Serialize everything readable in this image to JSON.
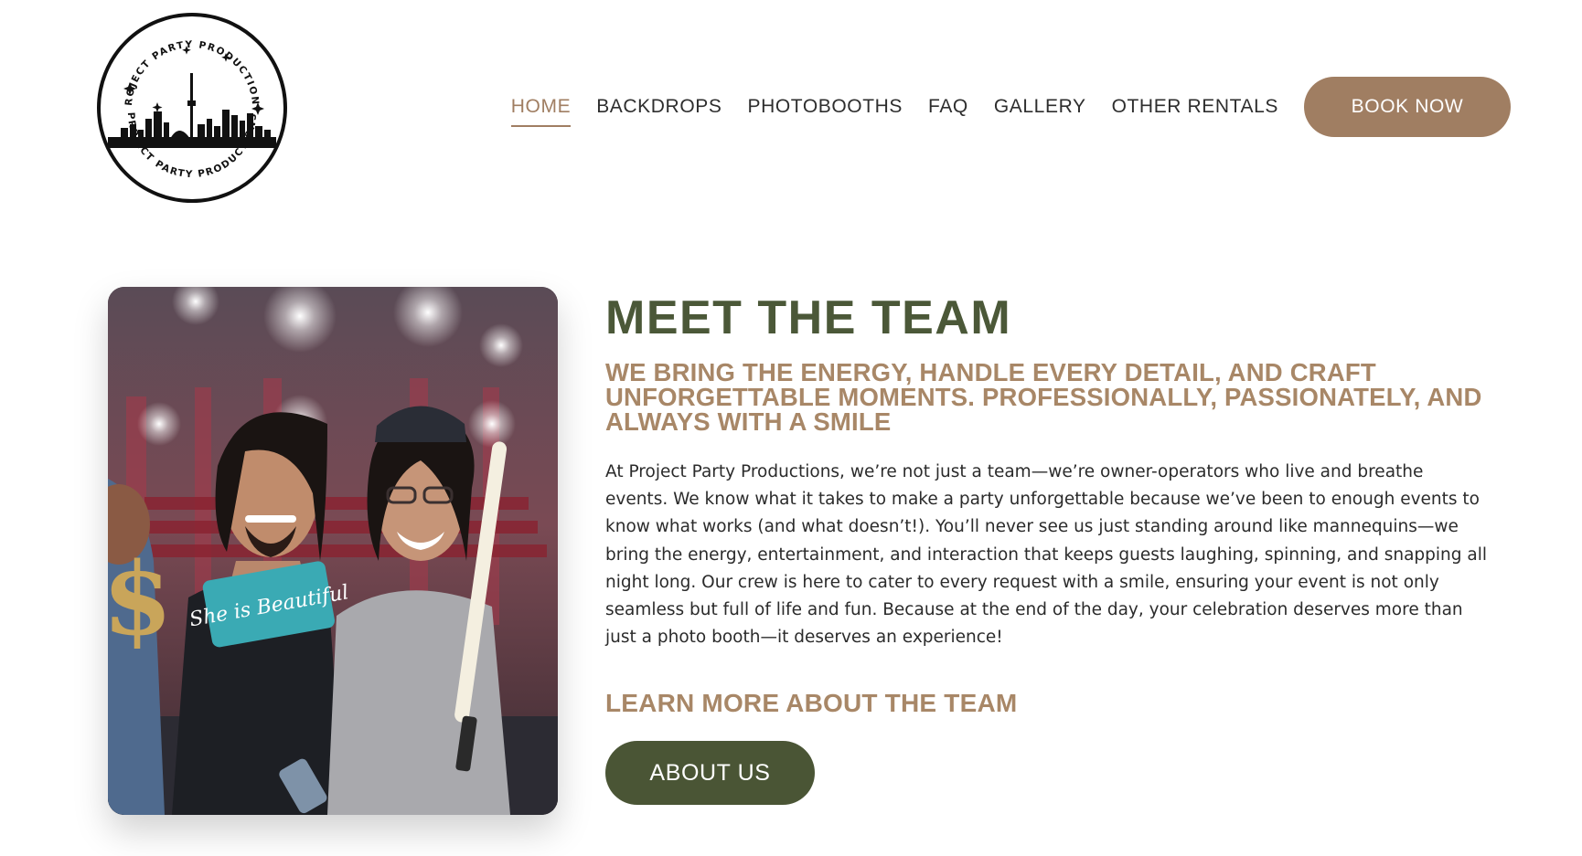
{
  "brand": {
    "logo_text": "PROJECT PARTY PRODUCTIONS",
    "logo_icon": "toronto-skyline-icon"
  },
  "nav": {
    "items": [
      {
        "label": "HOME",
        "active": true
      },
      {
        "label": "BACKDROPS",
        "active": false
      },
      {
        "label": "PHOTOBOOTHS",
        "active": false
      },
      {
        "label": "FAQ",
        "active": false
      },
      {
        "label": "GALLERY",
        "active": false
      },
      {
        "label": "OTHER RENTALS",
        "active": false
      }
    ],
    "cta_label": "BOOK NOW"
  },
  "team_section": {
    "title": "MEET THE TEAM",
    "subtitle": "WE BRING THE ENERGY, HANDLE EVERY DETAIL, AND CRAFT UNFORGETTABLE MOMENTS. PROFESSIONALLY, PASSIONATELY, AND ALWAYS WITH A SMILE",
    "body": "At Project Party Productions, we’re not just a team—we’re owner-operators who live and breathe events. We know what it takes to make a party unforgettable because we’ve been to enough events to know what works (and what doesn’t!). You’ll never see us just standing around like mannequins—we bring the energy, entertainment, and interaction that keeps guests laughing, spinning, and snapping all night long. Our crew is here to cater to every request with a smile, ensuring your event is not only seamless but full of life and fun. Because at the end of the day, your celebration deserves more than just a photo booth—it deserves an experience!",
    "learn_more": "LEARN MORE ABOUT THE TEAM",
    "button_label": "ABOUT US",
    "photo_sign_text": "She is Beautiful"
  },
  "colors": {
    "accent_brown": "#a07e62",
    "olive_green": "#4a5535",
    "title_green": "#4b5838"
  }
}
